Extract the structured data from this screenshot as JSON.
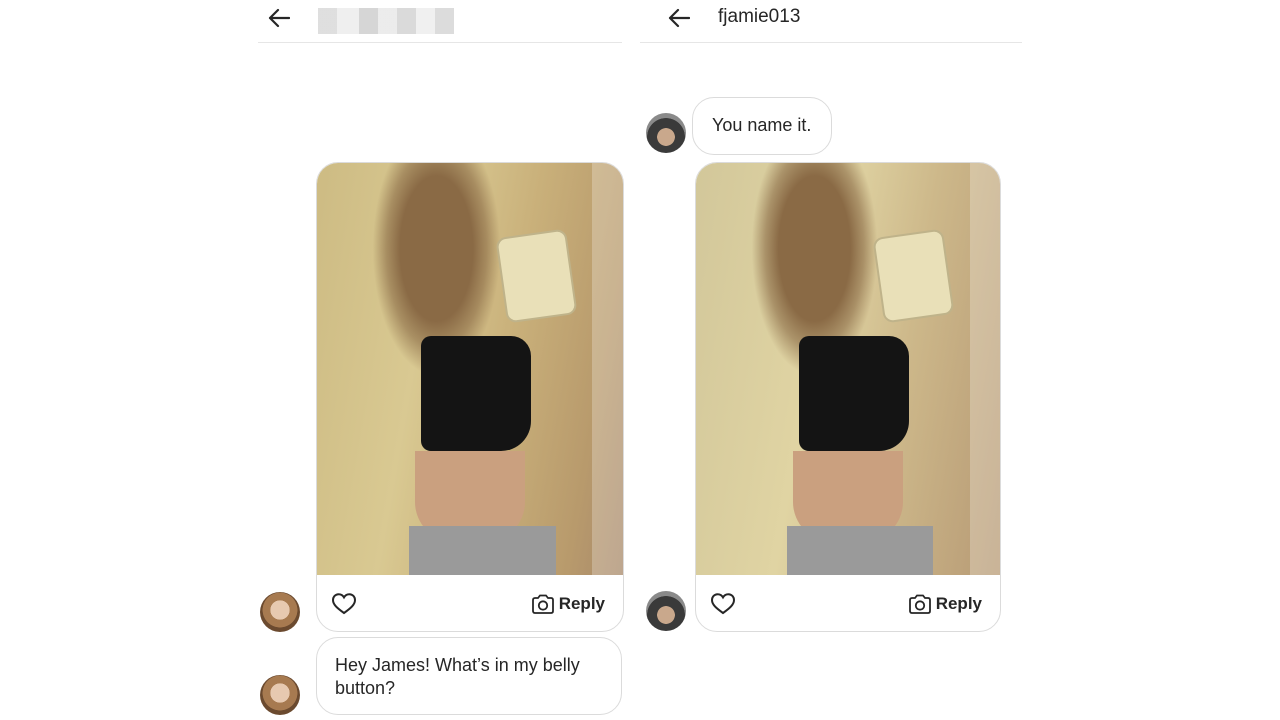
{
  "left_thread": {
    "header": {
      "back_icon": "arrow-left-icon"
    },
    "received_message": "Hey James! What’s in my belly button?",
    "media_actions": {
      "reply_label": "Reply",
      "like_icon": "heart-icon",
      "camera_icon": "camera-icon"
    }
  },
  "right_thread": {
    "header": {
      "back_icon": "arrow-left-icon",
      "username": "fjamie013"
    },
    "received_message": "You name it.",
    "media_actions": {
      "reply_label": "Reply",
      "like_icon": "heart-icon",
      "camera_icon": "camera-icon"
    }
  }
}
